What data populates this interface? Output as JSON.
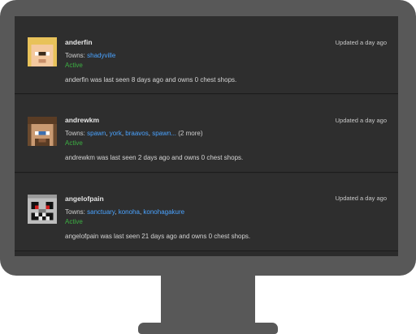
{
  "players": [
    {
      "name": "anderfin",
      "towns_label": "Towns:",
      "towns": [
        "shadyville"
      ],
      "more": "",
      "status": "Active",
      "description": "anderfin was last seen 8 days ago and owns 0 chest shops.",
      "updated": "Updated a day ago",
      "avatar": "blonde-skin-avatar-icon"
    },
    {
      "name": "andrewkm",
      "towns_label": "Towns:",
      "towns": [
        "spawn",
        "york",
        "braavos",
        "spawn..."
      ],
      "more": "(2 more)",
      "status": "Active",
      "description": "andrewkm was last seen 2 days ago and owns 0 chest shops.",
      "updated": "Updated a day ago",
      "avatar": "brown-hair-skin-avatar-icon"
    },
    {
      "name": "angelofpain",
      "towns_label": "Towns:",
      "towns": [
        "sanctuary",
        "konoha",
        "konohagakure"
      ],
      "more": "",
      "status": "Active",
      "description": "angelofpain was last seen 21 days ago and owns 0 chest shops.",
      "updated": "Updated a day ago",
      "avatar": "skull-skin-avatar-icon"
    }
  ],
  "colors": {
    "link": "#4aa3ff",
    "active": "#3cb043",
    "card_bg": "#2e2e2e",
    "bezel": "#585858"
  }
}
